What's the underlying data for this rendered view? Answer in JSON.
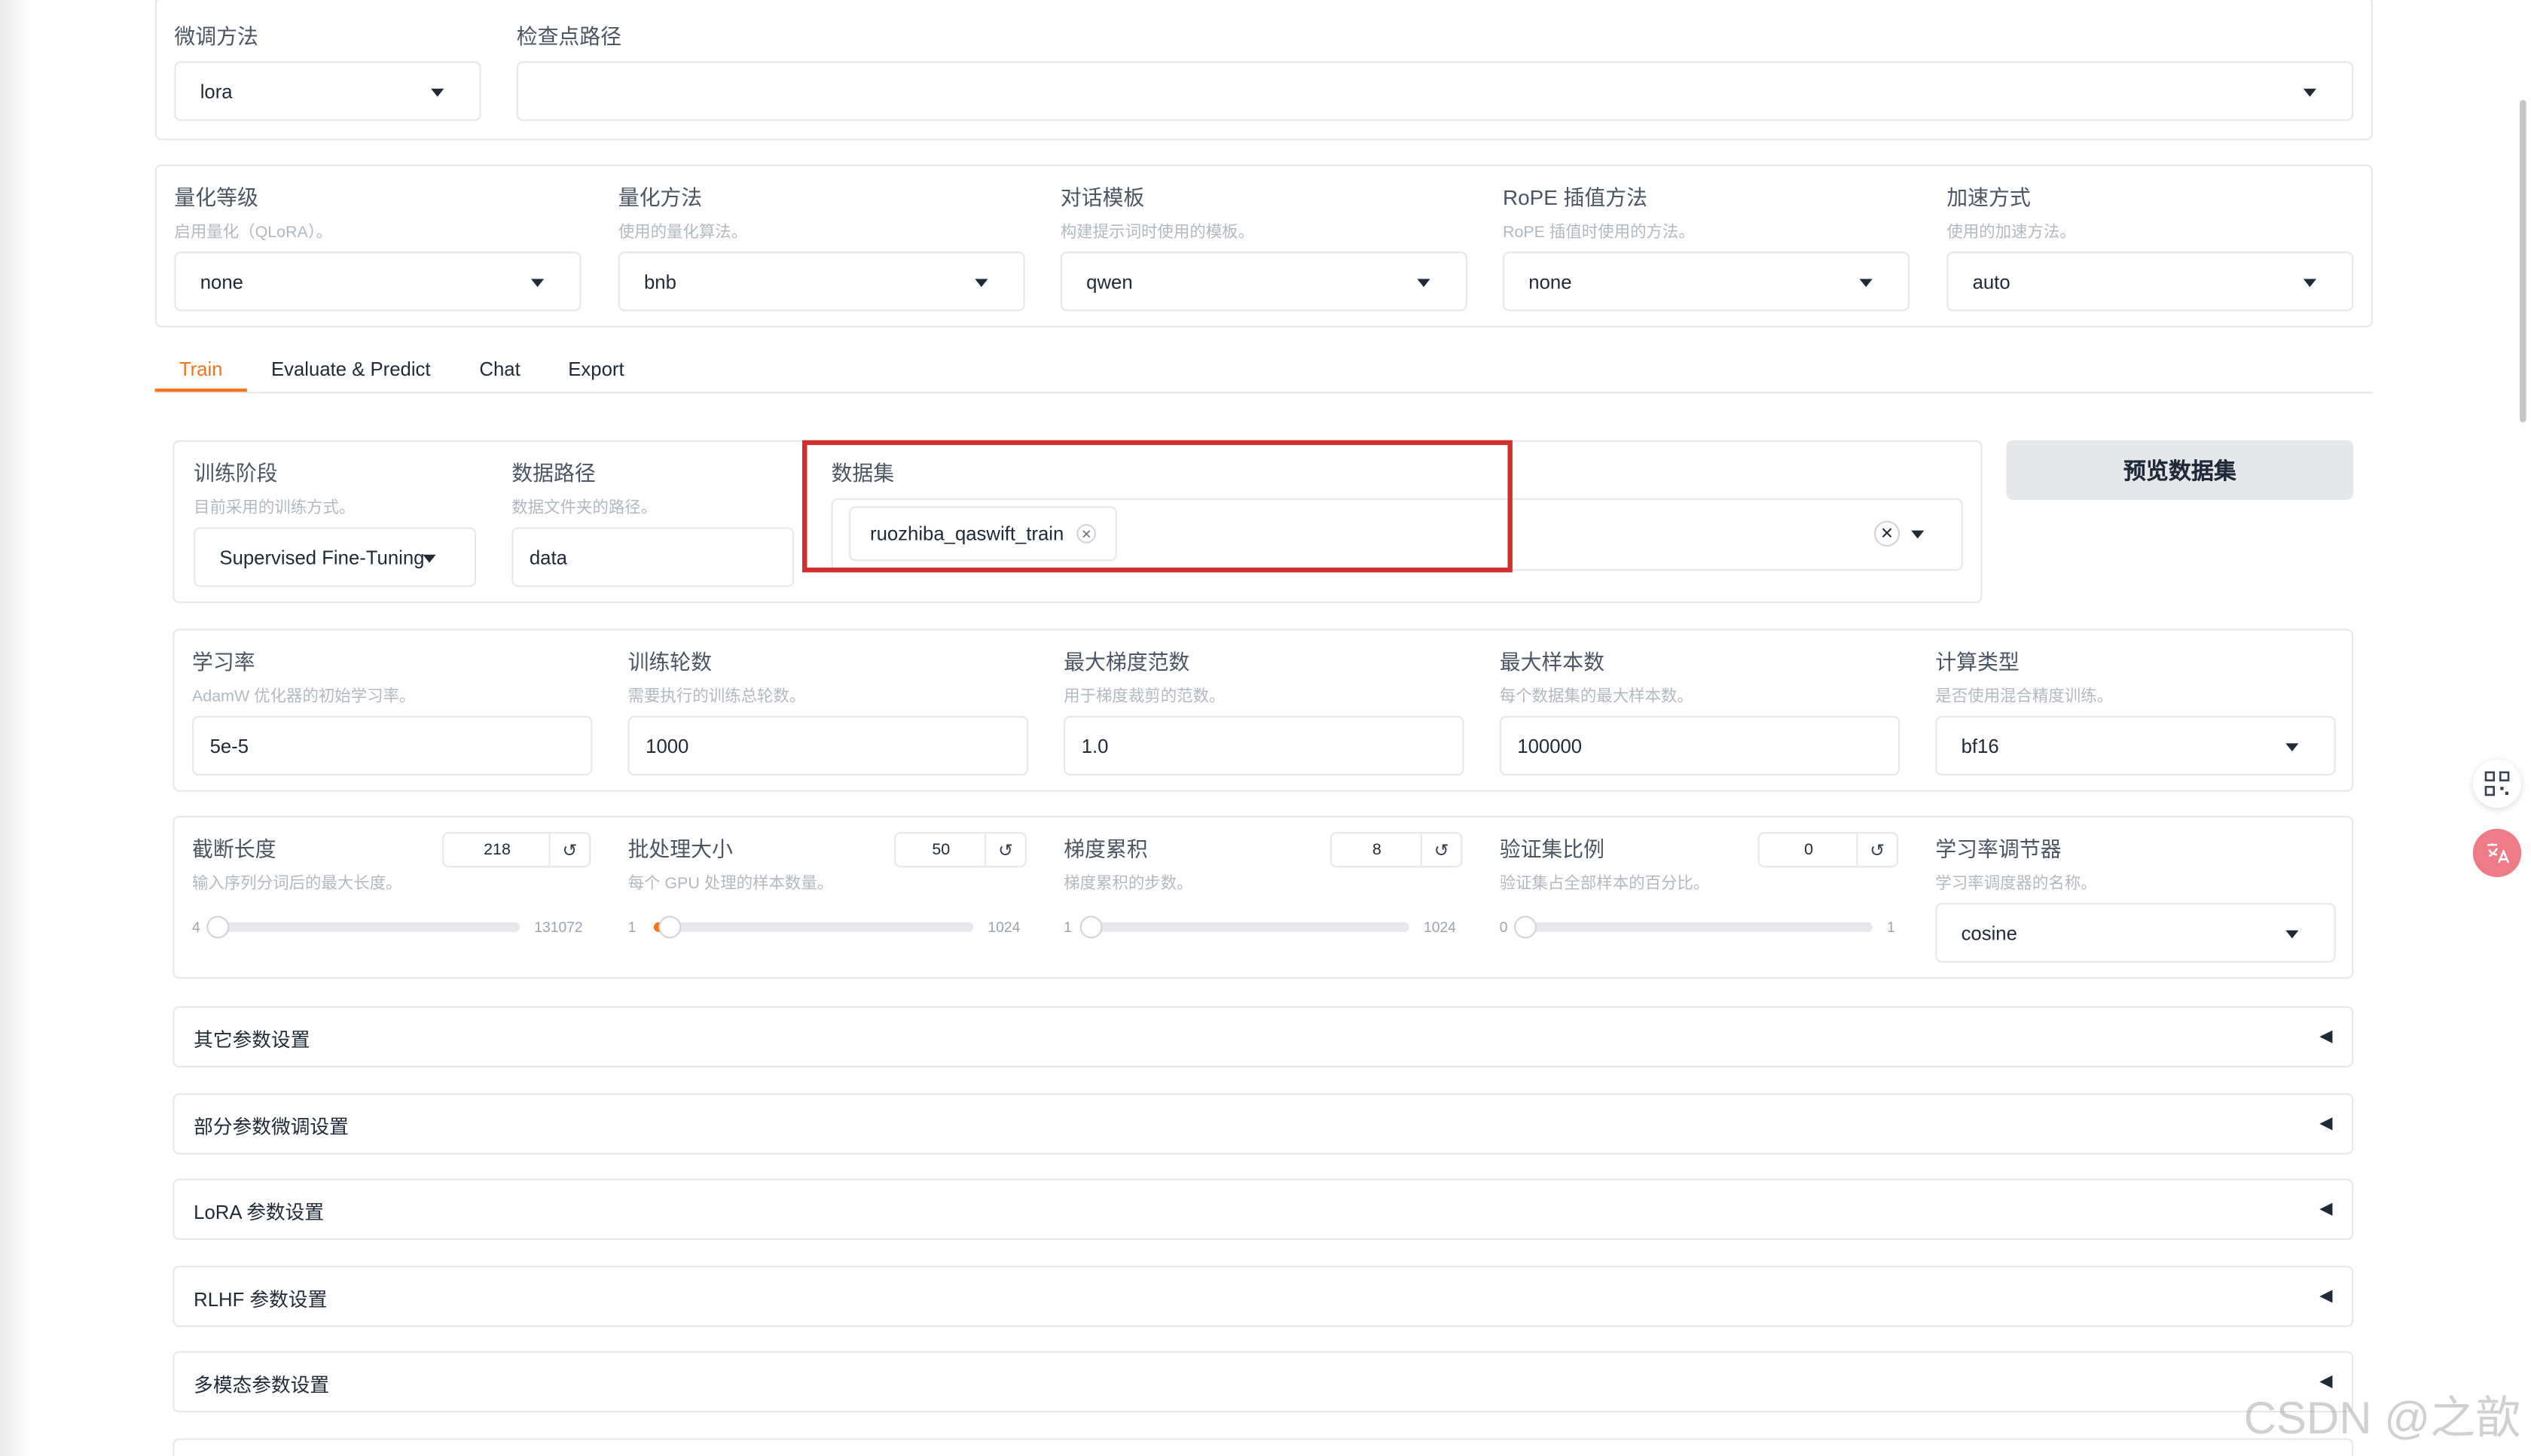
{
  "top": {
    "finetune_method": {
      "label": "微调方法",
      "value": "lora"
    },
    "checkpoint_path": {
      "label": "检查点路径",
      "value": ""
    }
  },
  "model_opts": [
    {
      "label": "量化等级",
      "info": "启用量化（QLoRA）。",
      "value": "none"
    },
    {
      "label": "量化方法",
      "info": "使用的量化算法。",
      "value": "bnb"
    },
    {
      "label": "对话模板",
      "info": "构建提示词时使用的模板。",
      "value": "qwen"
    },
    {
      "label": "RoPE 插值方法",
      "info": "RoPE 插值时使用的方法。",
      "value": "none"
    },
    {
      "label": "加速方式",
      "info": "使用的加速方法。",
      "value": "auto"
    }
  ],
  "tabs": [
    "Train",
    "Evaluate & Predict",
    "Chat",
    "Export"
  ],
  "train": {
    "stage": {
      "label": "训练阶段",
      "info": "目前采用的训练方式。",
      "value": "Supervised Fine-Tuning"
    },
    "dataset_dir": {
      "label": "数据路径",
      "info": "数据文件夹的路径。",
      "value": "data"
    },
    "dataset": {
      "label": "数据集",
      "chip": "ruozhiba_qaswift_train"
    },
    "preview_button": "预览数据集"
  },
  "hparams": [
    {
      "label": "学习率",
      "info": "AdamW 优化器的初始学习率。",
      "value": "5e-5"
    },
    {
      "label": "训练轮数",
      "info": "需要执行的训练总轮数。",
      "value": "1000"
    },
    {
      "label": "最大梯度范数",
      "info": "用于梯度裁剪的范数。",
      "value": "1.0"
    },
    {
      "label": "最大样本数",
      "info": "每个数据集的最大样本数。",
      "value": "100000"
    },
    {
      "label": "计算类型",
      "info": "是否使用混合精度训练。",
      "value": "bf16"
    }
  ],
  "sliders": [
    {
      "label": "截断长度",
      "info": "输入序列分词后的最大长度。",
      "value": "218",
      "min": "4",
      "max": "131072",
      "fraction": 0.0016
    },
    {
      "label": "批处理大小",
      "info": "每个 GPU 处理的样本数量。",
      "value": "50",
      "min": "1",
      "max": "1024",
      "fraction": 0.048
    },
    {
      "label": "梯度累积",
      "info": "梯度累积的步数。",
      "value": "8",
      "min": "1",
      "max": "1024",
      "fraction": 0.0068
    },
    {
      "label": "验证集比例",
      "info": "验证集占全部样本的百分比。",
      "value": "0",
      "min": "0",
      "max": "1",
      "fraction": 0.0
    }
  ],
  "scheduler": {
    "label": "学习率调节器",
    "info": "学习率调度器的名称。",
    "value": "cosine"
  },
  "accordions": [
    "其它参数设置",
    "部分参数微调设置",
    "LoRA 参数设置",
    "RLHF 参数设置",
    "多模态参数设置"
  ],
  "watermark": "CSDN @之歆",
  "colors": {
    "accent": "#f97316",
    "highlight": "#d32f2f"
  }
}
